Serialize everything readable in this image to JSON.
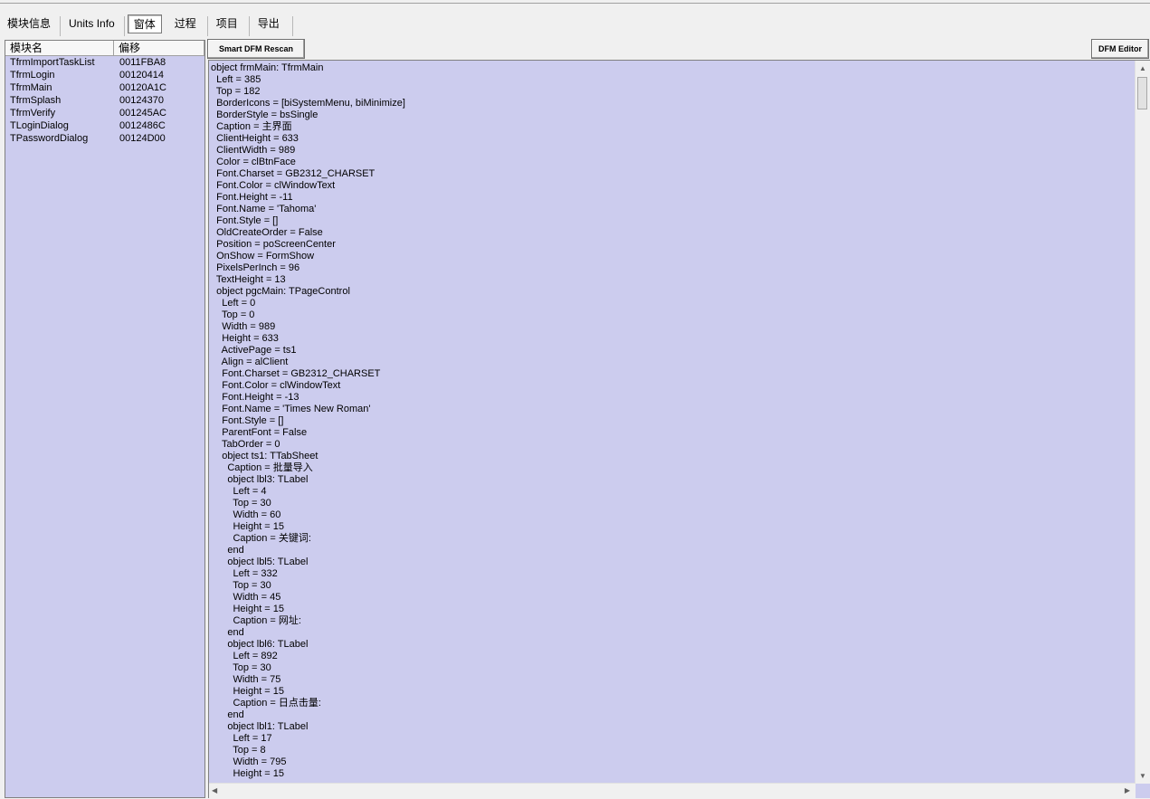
{
  "tabs": [
    {
      "label": "模块信息",
      "active": false
    },
    {
      "label": "Units Info",
      "active": false
    },
    {
      "label": "窗体",
      "active": true
    },
    {
      "label": "过程",
      "active": false
    },
    {
      "label": "项目",
      "active": false
    },
    {
      "label": "导出",
      "active": false
    }
  ],
  "module_list": {
    "columns": [
      "模块名",
      "偏移"
    ],
    "rows": [
      {
        "name": "TfrmImportTaskList",
        "offset": "0011FBA8"
      },
      {
        "name": "TfrmLogin",
        "offset": "00120414"
      },
      {
        "name": "TfrmMain",
        "offset": "00120A1C"
      },
      {
        "name": "TfrmSplash",
        "offset": "00124370"
      },
      {
        "name": "TfrmVerify",
        "offset": "001245AC"
      },
      {
        "name": "TLoginDialog",
        "offset": "0012486C"
      },
      {
        "name": "TPasswordDialog",
        "offset": "00124D00"
      }
    ]
  },
  "toolbar": {
    "rescan_label": "Smart DFM Rescan",
    "dfm_editor_label": "DFM Editor"
  },
  "dfm_lines": [
    "object frmMain: TfrmMain",
    "  Left = 385",
    "  Top = 182",
    "  BorderIcons = [biSystemMenu, biMinimize]",
    "  BorderStyle = bsSingle",
    "  Caption = 主界面",
    "  ClientHeight = 633",
    "  ClientWidth = 989",
    "  Color = clBtnFace",
    "  Font.Charset = GB2312_CHARSET",
    "  Font.Color = clWindowText",
    "  Font.Height = -11",
    "  Font.Name = 'Tahoma'",
    "  Font.Style = []",
    "  OldCreateOrder = False",
    "  Position = poScreenCenter",
    "  OnShow = FormShow",
    "  PixelsPerInch = 96",
    "  TextHeight = 13",
    "  object pgcMain: TPageControl",
    "    Left = 0",
    "    Top = 0",
    "    Width = 989",
    "    Height = 633",
    "    ActivePage = ts1",
    "    Align = alClient",
    "    Font.Charset = GB2312_CHARSET",
    "    Font.Color = clWindowText",
    "    Font.Height = -13",
    "    Font.Name = 'Times New Roman'",
    "    Font.Style = []",
    "    ParentFont = False",
    "    TabOrder = 0",
    "    object ts1: TTabSheet",
    "      Caption = 批量导入",
    "      object lbl3: TLabel",
    "        Left = 4",
    "        Top = 30",
    "        Width = 60",
    "        Height = 15",
    "        Caption = 关键词:",
    "      end",
    "      object lbl5: TLabel",
    "        Left = 332",
    "        Top = 30",
    "        Width = 45",
    "        Height = 15",
    "        Caption = 网址:",
    "      end",
    "      object lbl6: TLabel",
    "        Left = 892",
    "        Top = 30",
    "        Width = 75",
    "        Height = 15",
    "        Caption = 日点击量:",
    "      end",
    "      object lbl1: TLabel",
    "        Left = 17",
    "        Top = 8",
    "        Width = 795",
    "        Height = 15"
  ]
}
